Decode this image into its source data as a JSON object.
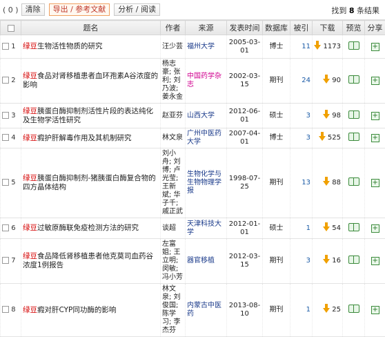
{
  "toolbar": {
    "selected": "( 0 )",
    "clear": "清除",
    "export": "导出 / 参考文献",
    "analyze": "分析 / 阅读",
    "result_prefix": "找到",
    "result_count": "8",
    "result_suffix": "条结果"
  },
  "columns": [
    "",
    "题名",
    "作者",
    "来源",
    "发表时间",
    "数据库",
    "被引",
    "下载",
    "预览",
    "分享"
  ],
  "rows": [
    {
      "num": "1",
      "hl": "绿豆",
      "rest": "生物活性物质的研究",
      "author": "汪少芸",
      "source": "福州大学",
      "date": "2005-03-01",
      "db": "博士",
      "cite": "11",
      "dl": "1173"
    },
    {
      "num": "2",
      "hl": "绿豆",
      "rest": "食品对肾移植患者血环孢素A谷浓度的影响",
      "author": "杨志豪; 张利; 刘乃波; 姜永金",
      "source": "中国药学杂志",
      "date": "2002-03-15",
      "db": "期刊",
      "cite": "24",
      "dl": "90"
    },
    {
      "num": "3",
      "hl": "绿豆",
      "rest": "胰蛋白酶抑制剂活性片段的表达纯化及生物学活性研究",
      "author": "赵亚芬",
      "source": "山西大学",
      "date": "2012-06-01",
      "db": "硕士",
      "cite": "3",
      "dl": "98"
    },
    {
      "num": "4",
      "hl": "绿豆",
      "rest": "瘕护肝解毒作用及其机制研究",
      "author": "林文泉",
      "source": "广州中医药大学",
      "date": "2007-04-01",
      "db": "博士",
      "cite": "3",
      "dl": "525"
    },
    {
      "num": "5",
      "hl": "绿豆",
      "rest": "胰蛋白酶抑制剂-猪胰蛋白酶复合物的四方晶体结构",
      "author": "刘小舟; 刘博; 卢光莹; 王新斌; 华子千; 戚正武",
      "source": "生物化学与生物物理学报",
      "date": "1998-07-25",
      "db": "期刊",
      "cite": "13",
      "dl": "88"
    },
    {
      "num": "6",
      "hl": "绿豆",
      "rest": "过敏原酶联免疫检测方法的研究",
      "author": "谈超",
      "source": "天津科技大学",
      "date": "2012-01-01",
      "db": "硕士",
      "cite": "1",
      "dl": "54"
    },
    {
      "num": "7",
      "hl": "绿豆",
      "rest": "食品降低肾移植患者他克莫司血药谷浓度1例报告",
      "author": "左富姐; 王立明; 闵敏; 冯小芳",
      "source": "器官移植",
      "date": "2012-03-15",
      "db": "期刊",
      "cite": "3",
      "dl": "16"
    },
    {
      "num": "8",
      "hl": "绿豆",
      "rest": "瘕对肝CYP同功酶的影响",
      "author": "林文泉; 刘俊国; 陈学习; 李杰芬",
      "source": "内蒙古中医药",
      "date": "2013-08-10",
      "db": "期刊",
      "cite": "1",
      "dl": "25"
    }
  ]
}
